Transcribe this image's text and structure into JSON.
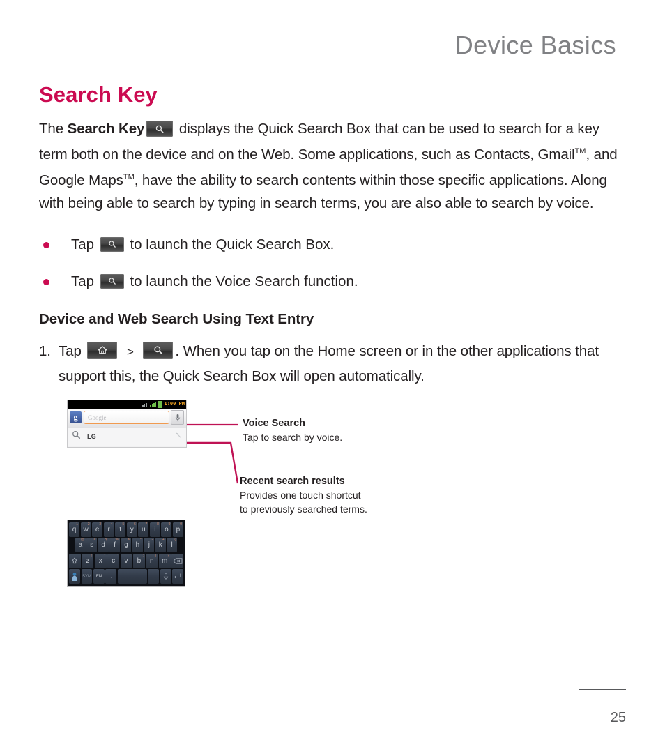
{
  "running_head": "Device Basics",
  "section": {
    "title": "Search Key",
    "intro_parts": {
      "p1": "The ",
      "p2": "Search Key",
      "key_icon": "search-icon",
      "p3": " displays the Quick Search Box that can be used to search for a key term both on the device and on the Web. Some applications, such as Contacts, Gmail",
      "tm1": "TM",
      "p4": ", and Google Maps",
      "tm2": "TM",
      "p5": ", have the ability to search contents within those specific applications. Along with being able to search by typing in search terms, you are also able to search by voice."
    }
  },
  "bullets": [
    {
      "lead": "Tap",
      "icon": "search-icon",
      "rest": "to launch the Quick Search Box."
    },
    {
      "lead": "Tap",
      "icon": "search-icon",
      "rest": "to launch the Voice  Search function."
    }
  ],
  "subsection": {
    "title": "Device and Web Search Using Text Entry",
    "step": {
      "number": "1.",
      "lead": "Tap",
      "icon1": "home-icon",
      "separator": ">",
      "icon2": "search-icon",
      "rest": ". When you tap on the Home screen or in the other applications that support this, the Quick Search Box will open automatically."
    }
  },
  "figure": {
    "phone_screenshot": {
      "status_time": "1:00 PM",
      "google_badge": "g",
      "search_placeholder": "Google",
      "mic_icon": "microphone-icon",
      "recent": {
        "icon": "search-icon",
        "label": "LG",
        "arrow_icon": "arrow-up-left-icon"
      }
    },
    "keyboard": {
      "row1": [
        {
          "key": "q",
          "alt": "1"
        },
        {
          "key": "w",
          "alt": "2"
        },
        {
          "key": "e",
          "alt": "3"
        },
        {
          "key": "r",
          "alt": "4"
        },
        {
          "key": "t",
          "alt": "5"
        },
        {
          "key": "y",
          "alt": "6"
        },
        {
          "key": "u",
          "alt": "7"
        },
        {
          "key": "i",
          "alt": "8"
        },
        {
          "key": "o",
          "alt": "9"
        },
        {
          "key": "p",
          "alt": "0"
        }
      ],
      "row2": [
        {
          "key": "a",
          "alt": "@"
        },
        {
          "key": "s",
          "alt": "#"
        },
        {
          "key": "d",
          "alt": "$"
        },
        {
          "key": "f",
          "alt": "%"
        },
        {
          "key": "g",
          "alt": "&"
        },
        {
          "key": "h",
          "alt": "*"
        },
        {
          "key": "j",
          "alt": "-"
        },
        {
          "key": "k",
          "alt": "+"
        },
        {
          "key": "l",
          "alt": "("
        }
      ],
      "row3": [
        {
          "key": "shift-icon",
          "alt": ""
        },
        {
          "key": "z",
          "alt": "!"
        },
        {
          "key": "x",
          "alt": "\""
        },
        {
          "key": "c",
          "alt": "'"
        },
        {
          "key": "v",
          "alt": ":"
        },
        {
          "key": "b",
          "alt": ";"
        },
        {
          "key": "n",
          "alt": "/"
        },
        {
          "key": "m",
          "alt": "?"
        },
        {
          "key": "backspace-icon",
          "alt": ""
        }
      ],
      "row4": [
        {
          "key": "settings-icon",
          "alt": ""
        },
        {
          "key": "SYM",
          "alt": ""
        },
        {
          "key": "EN",
          "alt": ""
        },
        {
          "key": ",",
          "alt": ""
        },
        {
          "key": "space",
          "alt": ""
        },
        {
          "key": ".",
          "alt": ""
        },
        {
          "key": "microphone-icon",
          "alt": ""
        },
        {
          "key": "enter-icon",
          "alt": ""
        }
      ]
    },
    "annotations": [
      {
        "title": "Voice Search",
        "desc": "Tap to search by voice."
      },
      {
        "title": "Recent search results",
        "desc_line1": "Provides one touch shortcut",
        "desc_line2": "to previously searched terms."
      }
    ]
  },
  "footer": {
    "page_number": "25"
  },
  "colors": {
    "accent": "#cb0b51",
    "running_head": "#808184",
    "body": "#231f20",
    "footer": "#58595b"
  }
}
